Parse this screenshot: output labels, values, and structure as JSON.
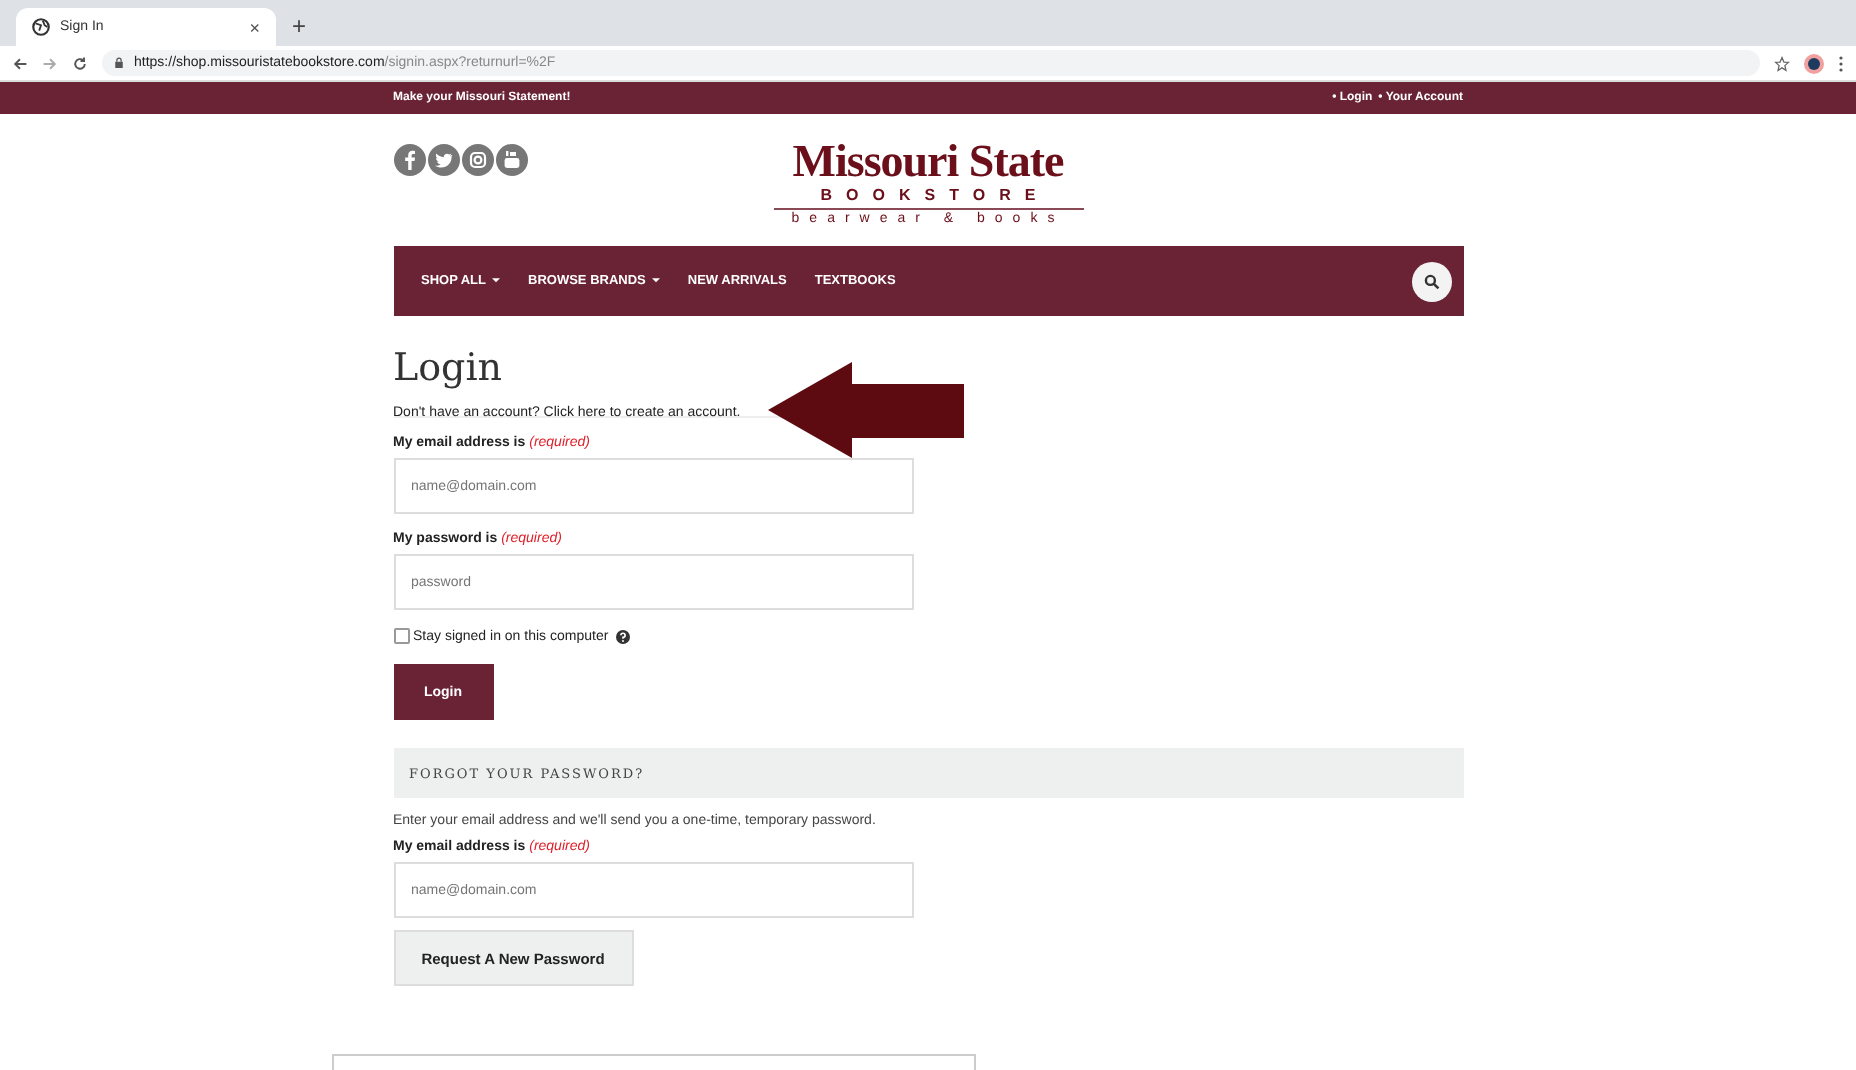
{
  "browser": {
    "tab_title": "Sign In",
    "tab_close": "×",
    "new_tab": "+",
    "url_host": "https://shop.missouristatebookstore.com",
    "url_path": "/signin.aspx?returnurl=%2F"
  },
  "banner": {
    "tagline": "Make your Missouri Statement!",
    "links": [
      {
        "label": "• Login"
      },
      {
        "label": "• Your Account"
      }
    ]
  },
  "logo": {
    "name": "Missouri State",
    "subtitle": "BOOKSTORE",
    "slogan": "bearwear & books"
  },
  "nav": {
    "items": [
      {
        "label": "SHOP ALL",
        "dropdown": true
      },
      {
        "label": "BROWSE BRANDS",
        "dropdown": true
      },
      {
        "label": "NEW ARRIVALS",
        "dropdown": false
      },
      {
        "label": "TEXTBOOKS",
        "dropdown": false
      }
    ]
  },
  "login": {
    "title": "Login",
    "create_prompt": "Don't have an account? Click here to create an account.",
    "fields": [
      {
        "label": "My email address is",
        "required": "(required)",
        "placeholder": "name@domain.com"
      },
      {
        "label": "My password is",
        "required": "(required)",
        "placeholder": "password"
      }
    ],
    "stay_signed_in": {
      "label": "Stay signed in on this computer",
      "checked": false
    },
    "button": "Login"
  },
  "forgot": {
    "heading": "FORGOT YOUR PASSWORD?",
    "intro": "Enter your email address and we'll send you a one-time, temporary password.",
    "field": {
      "label": "My email address is",
      "required": "(required)",
      "placeholder": "name@domain.com"
    },
    "button": "Request A New Password"
  }
}
